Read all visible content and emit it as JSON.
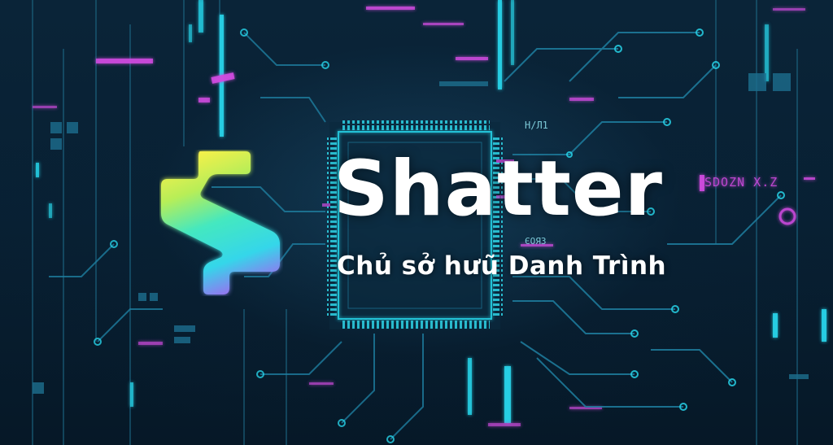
{
  "brand": {
    "name": "Shatter",
    "tagline": "Chủ sở hưũ Danh Trình",
    "logo_icon": "shatter-s-logo-icon"
  },
  "background": {
    "theme": "circuit-board",
    "labels": [
      "H/Л1",
      "ЄОЯЗ",
      "SDOZN X.Z"
    ]
  },
  "colors": {
    "background": "#071a2a",
    "cyan": "#27d3e8",
    "magenta": "#d04be0",
    "logo_gradient": [
      "#f7f04a",
      "#44e8c0",
      "#35d6ea",
      "#9a6ff0"
    ],
    "text": "#ffffff"
  }
}
